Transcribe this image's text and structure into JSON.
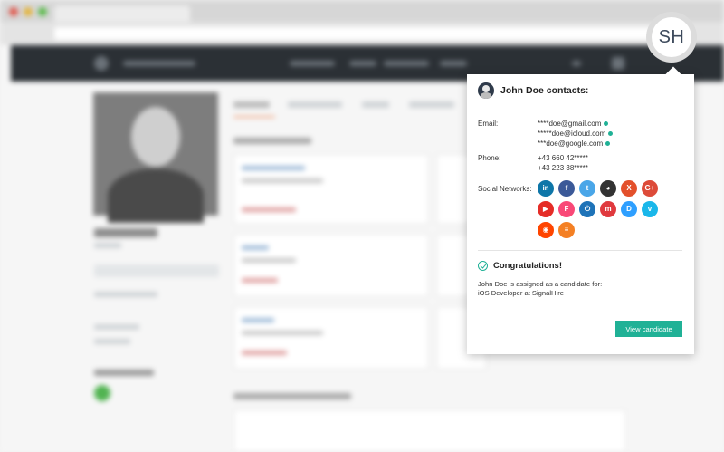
{
  "avatar": {
    "initials": "SH"
  },
  "popup": {
    "title": "John Doe contacts:",
    "email": {
      "label": "Email:",
      "values": [
        "****doe@gmail.com",
        "*****doe@icloud.com",
        "***doe@google.com"
      ]
    },
    "phone": {
      "label": "Phone:",
      "values": [
        "+43 660 42*****",
        "+43 223 38*****"
      ]
    },
    "social": {
      "label": "Social Networks:",
      "items": [
        {
          "icon": "linkedin-icon",
          "glyph": "in",
          "color": "#0e76a8"
        },
        {
          "icon": "facebook-icon",
          "glyph": "f",
          "color": "#3b5998"
        },
        {
          "icon": "twitter-icon",
          "glyph": "t",
          "color": "#4aa6e8"
        },
        {
          "icon": "github-icon",
          "glyph": "◕",
          "color": "#333333"
        },
        {
          "icon": "xing-icon",
          "glyph": "X",
          "color": "#e3502b"
        },
        {
          "icon": "google-plus-icon",
          "glyph": "G+",
          "color": "#dd4b39"
        },
        {
          "icon": "youtube-icon",
          "glyph": "▶",
          "color": "#e52d27"
        },
        {
          "icon": "foursquare-icon",
          "glyph": "F",
          "color": "#f94877"
        },
        {
          "icon": "power-icon",
          "glyph": "⏻",
          "color": "#1e73b8"
        },
        {
          "icon": "meetup-icon",
          "glyph": "m",
          "color": "#e0393e"
        },
        {
          "icon": "disqus-icon",
          "glyph": "D",
          "color": "#2e9fff"
        },
        {
          "icon": "vimeo-icon",
          "glyph": "v",
          "color": "#1ab7ea"
        },
        {
          "icon": "reddit-icon",
          "glyph": "◉",
          "color": "#ff4500"
        },
        {
          "icon": "stackoverflow-icon",
          "glyph": "≡",
          "color": "#f48024"
        }
      ]
    },
    "congrats": {
      "title": "Congratulations!",
      "line1": "John Doe is assigned as a candidate for:",
      "line2": "iOS Developer at SignalHire"
    },
    "button": "View candidate"
  },
  "colors": {
    "accent": "#20b196",
    "navbar": "#2b3035"
  }
}
